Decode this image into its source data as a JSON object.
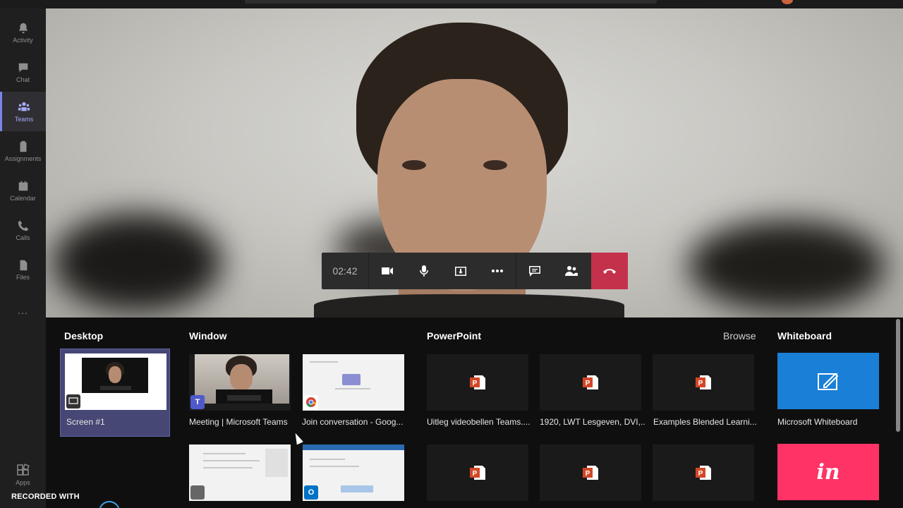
{
  "rail": {
    "items": [
      {
        "label": "Activity",
        "icon": "bell-icon"
      },
      {
        "label": "Chat",
        "icon": "chat-icon"
      },
      {
        "label": "Teams",
        "icon": "teams-icon",
        "active": true
      },
      {
        "label": "Assignments",
        "icon": "assignments-icon"
      },
      {
        "label": "Calendar",
        "icon": "calendar-icon"
      },
      {
        "label": "Calls",
        "icon": "phone-icon"
      },
      {
        "label": "Files",
        "icon": "files-icon"
      }
    ],
    "more": "...",
    "apps_label": "Apps"
  },
  "call": {
    "timer": "02:42",
    "buttons": [
      "camera-icon",
      "microphone-icon",
      "share-tray-icon",
      "more-options-icon",
      "chat-icon",
      "participants-icon",
      "hang-up-icon"
    ]
  },
  "share": {
    "desktop": {
      "title": "Desktop",
      "items": [
        {
          "label": "Screen #1"
        }
      ]
    },
    "window": {
      "title": "Window",
      "items": [
        {
          "label": "Meeting | Microsoft Teams"
        },
        {
          "label": "Join conversation - Goog..."
        },
        {
          "label": ""
        },
        {
          "label": ""
        }
      ]
    },
    "powerpoint": {
      "title": "PowerPoint",
      "browse": "Browse",
      "items": [
        {
          "label": "Uitleg videobellen Teams...."
        },
        {
          "label": "1920, LWT Lesgeven, DVI,..."
        },
        {
          "label": "Examples Blended Learni..."
        },
        {
          "label": ""
        },
        {
          "label": ""
        },
        {
          "label": ""
        }
      ]
    },
    "whiteboard": {
      "title": "Whiteboard",
      "items": [
        {
          "label": "Microsoft Whiteboard"
        },
        {
          "label": "",
          "logo_text": "in"
        }
      ]
    }
  },
  "colors": {
    "accent": "#6264a7",
    "hangup": "#c4314b",
    "whiteboard": "#1a7fd6",
    "invision": "#ff3366"
  },
  "watermark": "RECORDED WITH"
}
